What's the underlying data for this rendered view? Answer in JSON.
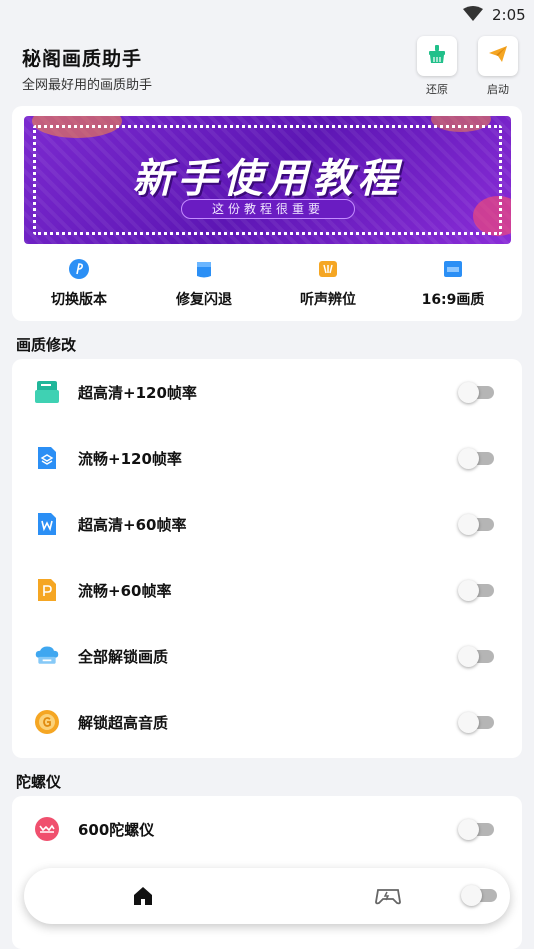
{
  "status_bar": {
    "time": "2:05",
    "wifi_icon": "wifi-icon"
  },
  "header": {
    "title": "秘阁画质助手",
    "subtitle": "全网最好用的画质助手",
    "restore_label": "还原",
    "launch_label": "启动"
  },
  "banner": {
    "title": "新手使用教程",
    "subtitle": "这份教程很重要"
  },
  "quick_actions": [
    {
      "label": "切换版本",
      "icon": "version-switch-icon",
      "color": "#2b8ff5"
    },
    {
      "label": "修复闪退",
      "icon": "repair-icon",
      "color": "#2b8ff5"
    },
    {
      "label": "听声辨位",
      "icon": "sound-locate-icon",
      "color": "#f5a623"
    },
    {
      "label": "16:9画质",
      "icon": "ratio-icon",
      "color": "#2b8ff5"
    }
  ],
  "quality_section": {
    "title": "画质修改",
    "items": [
      {
        "label": "超高清+120帧率",
        "icon": "teal-doc-icon",
        "color": "#20b69a",
        "enabled": false
      },
      {
        "label": "流畅+120帧率",
        "icon": "blue-layers-icon",
        "color": "#2b8ff5",
        "enabled": false
      },
      {
        "label": "超高清+60帧率",
        "icon": "word-doc-icon",
        "color": "#2b8ff5",
        "enabled": false
      },
      {
        "label": "流畅+60帧率",
        "icon": "ppt-doc-icon",
        "color": "#f5a623",
        "enabled": false
      },
      {
        "label": "全部解锁画质",
        "icon": "cloud-unlock-icon",
        "color": "#3fa7f0",
        "enabled": false
      },
      {
        "label": "解锁超高音质",
        "icon": "audio-coin-icon",
        "color": "#f5a623",
        "enabled": false
      }
    ]
  },
  "gyro_section": {
    "title": "陀螺仪",
    "items": [
      {
        "label": "600陀螺仪",
        "icon": "gyro-icon",
        "color": "#f0506e",
        "enabled": false
      }
    ]
  },
  "bottom_nav": {
    "home_icon": "home-icon",
    "game_icon": "gamepad-icon"
  },
  "colors": {
    "background": "#f2f3f6",
    "banner_purple": "#6a1cc2",
    "toggle_off": "#b5b5b5"
  }
}
